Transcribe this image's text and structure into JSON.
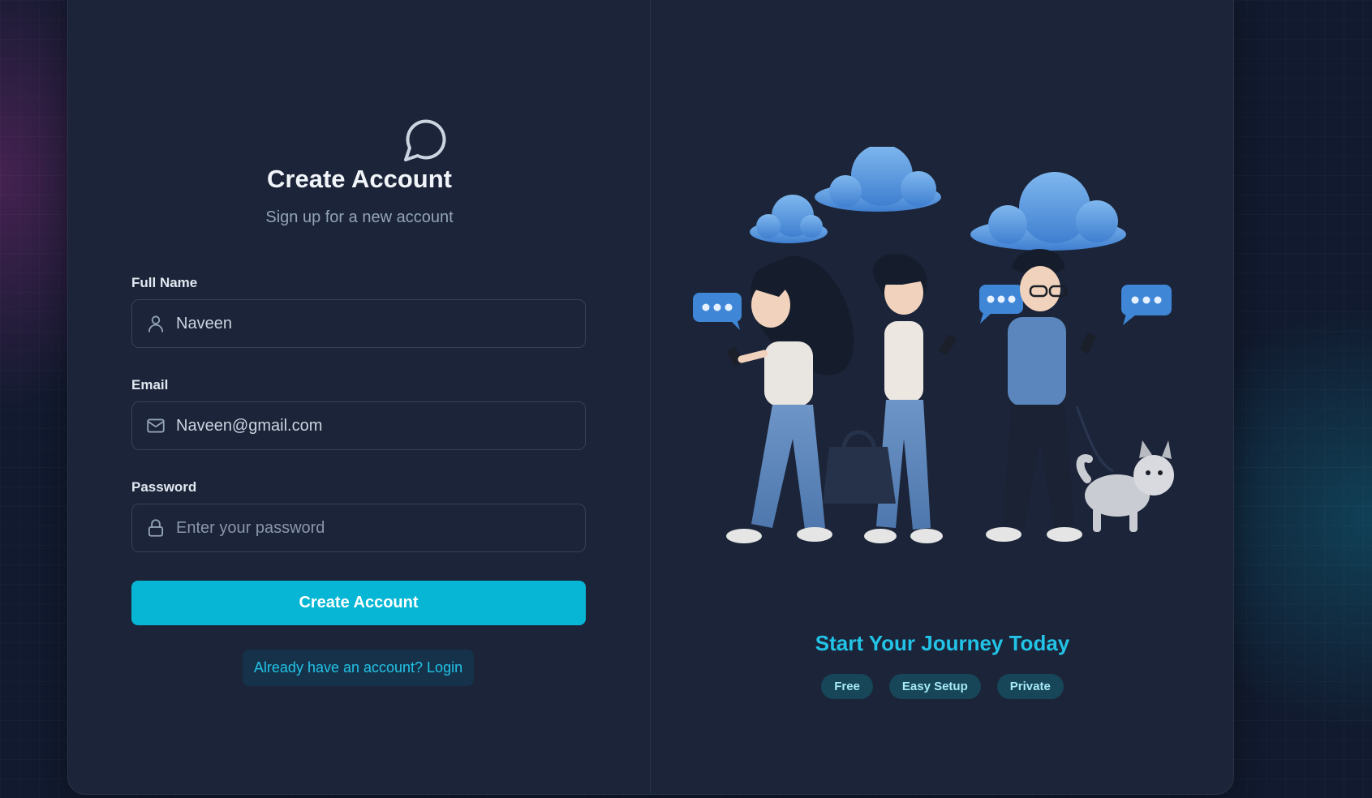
{
  "form": {
    "title": "Create Account",
    "subtitle": "Sign up for a new account",
    "fields": [
      {
        "label": "Full Name",
        "value": "Naveen",
        "placeholder": "",
        "icon": "user-icon"
      },
      {
        "label": "Email",
        "value": "Naveen@gmail.com",
        "placeholder": "",
        "icon": "mail-icon"
      },
      {
        "label": "Password",
        "value": "",
        "placeholder": "Enter your password",
        "icon": "lock-icon"
      }
    ],
    "submit_label": "Create Account",
    "login_link": "Already have an account? Login"
  },
  "hero": {
    "heading": "Start Your Journey Today",
    "tags": [
      "Free",
      "Easy Setup",
      "Private"
    ]
  },
  "colors": {
    "accent": "#06b6d4",
    "accent_text": "#22c3e6",
    "card": "#1b2438",
    "page": "#111a2e"
  },
  "icons": {
    "logo": "chat-bubble-icon"
  }
}
